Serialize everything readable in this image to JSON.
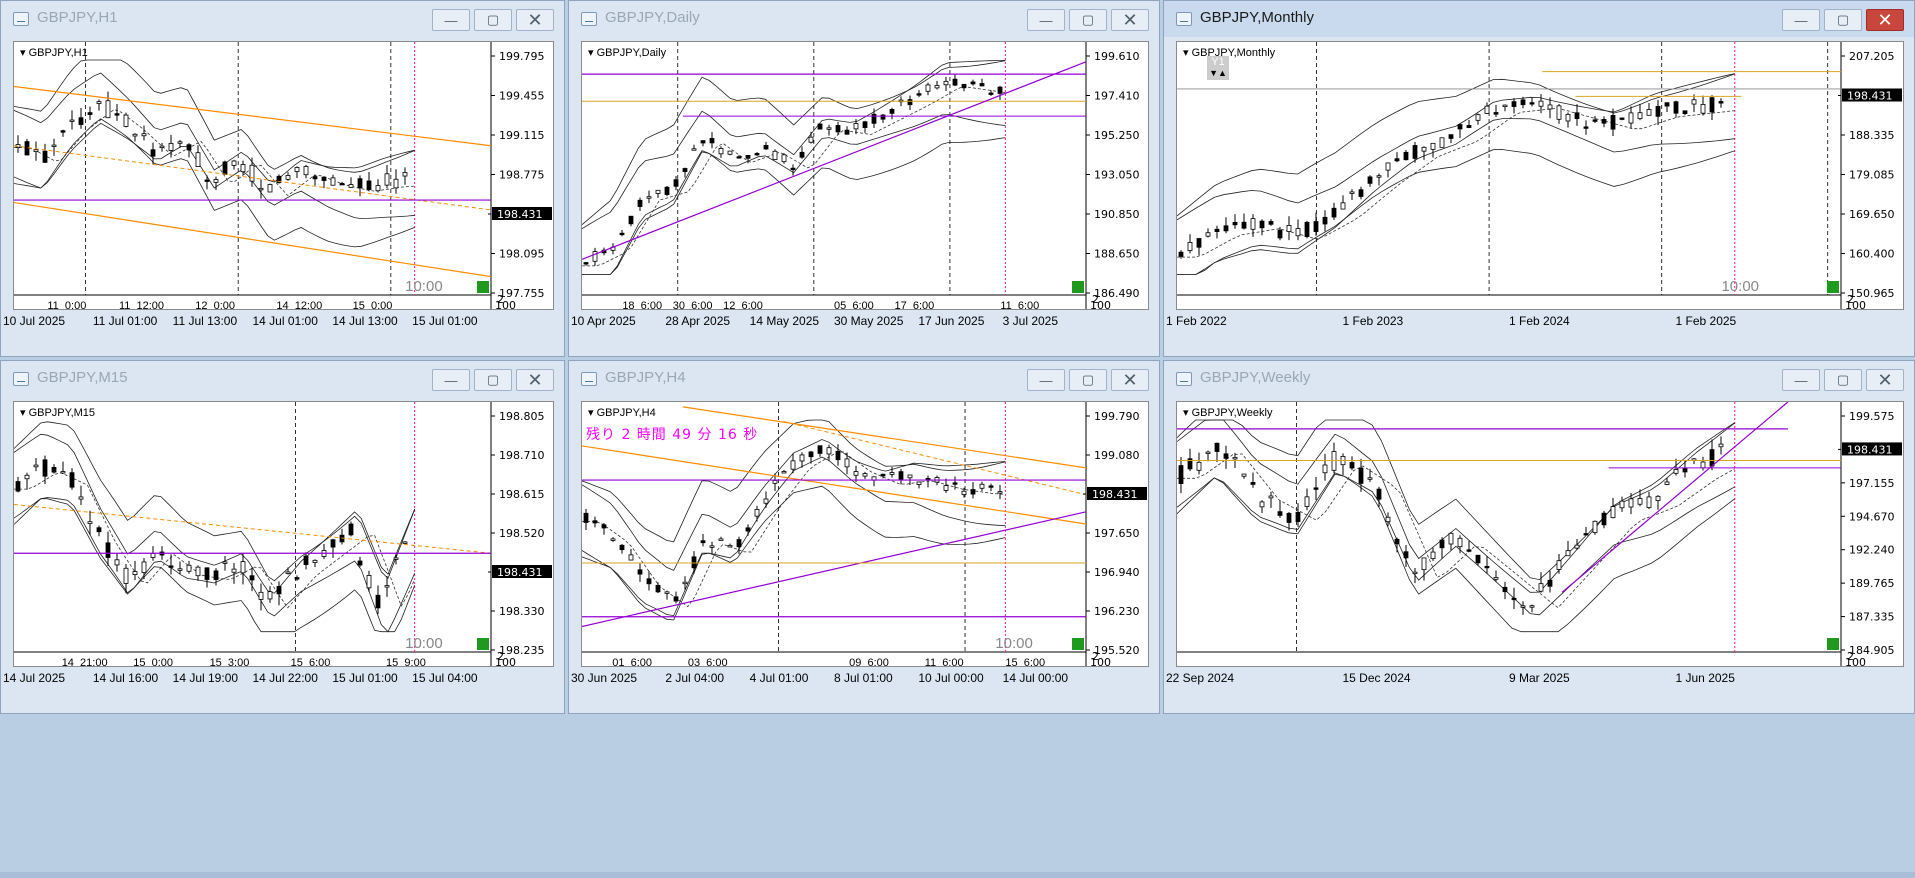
{
  "windows": [
    {
      "id": "h1",
      "title": "GBPJPY,H1",
      "symbol": "GBPJPY,H1",
      "active": false,
      "price_labels": [
        "199.795",
        "199.455",
        "199.115",
        "198.775",
        "198.431",
        "198.095",
        "197.755"
      ],
      "current_price": "198.431",
      "inner_time_labels": [
        "11_0:00",
        "11_12:00",
        "12_0:00",
        "14_12:00",
        "15_0:00"
      ],
      "date_labels": [
        "10 Jul 2025",
        "11 Jul 01:00",
        "11 Jul 13:00",
        "14 Jul 01:00",
        "14 Jul 13:00",
        "15 Jul 01:00"
      ],
      "time_left": "10:00",
      "corner_label": "2",
      "corner_label2": "0",
      "corner_label3": "100"
    },
    {
      "id": "daily",
      "title": "GBPJPY,Daily",
      "symbol": "GBPJPY,Daily",
      "active": false,
      "price_labels": [
        "199.610",
        "197.410",
        "195.250",
        "193.050",
        "190.850",
        "188.650",
        "186.490"
      ],
      "current_price": "198.431",
      "inner_time_labels": [
        "18_6:00",
        "30_6:00",
        "12_6:00",
        "05_6:00",
        "17_6:00",
        "11_6:00"
      ],
      "date_labels": [
        "10 Apr 2025",
        "28 Apr 2025",
        "14 May 2025",
        "30 May 2025",
        "17 Jun 2025",
        "3 Jul 2025"
      ],
      "time_left": "",
      "corner_label": "2",
      "corner_label2": "0",
      "corner_label3": "100"
    },
    {
      "id": "monthly",
      "title": "GBPJPY,Monthly",
      "symbol": "GBPJPY,Monthly",
      "active": true,
      "period_badge": "Y1",
      "price_labels": [
        "207.205",
        "198.431",
        "188.335",
        "179.085",
        "169.650",
        "160.400",
        "150.965"
      ],
      "current_price": "198.431",
      "inner_time_labels": [],
      "date_labels": [
        "1 Feb 2022",
        "1 Feb 2023",
        "1 Feb 2024",
        "1 Feb 2025"
      ],
      "time_left": "10:00",
      "corner_label": "2",
      "corner_label2": "0",
      "corner_label3": "100"
    },
    {
      "id": "m15",
      "title": "GBPJPY,M15",
      "symbol": "GBPJPY,M15",
      "active": false,
      "price_labels": [
        "198.805",
        "198.710",
        "198.615",
        "198.520",
        "198.431",
        "198.330",
        "198.235"
      ],
      "current_price": "198.431",
      "inner_time_labels": [
        "14_21:00",
        "15_0:00",
        "15_3:00",
        "15_6:00",
        "15_9:00"
      ],
      "date_labels": [
        "14 Jul 2025",
        "14 Jul 16:00",
        "14 Jul 19:00",
        "14 Jul 22:00",
        "15 Jul 01:00",
        "15 Jul 04:00"
      ],
      "time_left": "10:00",
      "corner_label": "2",
      "corner_label2": "0",
      "corner_label3": "100"
    },
    {
      "id": "h4",
      "title": "GBPJPY,H4",
      "symbol": "GBPJPY,H4",
      "active": false,
      "remaining": "残り 2 時間 49 分 16 秒",
      "price_labels": [
        "199.790",
        "199.080",
        "198.431",
        "197.650",
        "196.940",
        "196.230",
        "195.520"
      ],
      "current_price": "198.431",
      "inner_time_labels": [
        "01_6:00",
        "03_6:00",
        "09_6:00",
        "11_6:00",
        "15_6:00"
      ],
      "date_labels": [
        "30 Jun 2025",
        "2 Jul 04:00",
        "4 Jul 01:00",
        "8 Jul 01:00",
        "10 Jul 00:00",
        "14 Jul 00:00"
      ],
      "time_left": "10:00",
      "corner_label": "2",
      "corner_label2": "0",
      "corner_label3": "100"
    },
    {
      "id": "weekly",
      "title": "GBPJPY,Weekly",
      "symbol": "GBPJPY,Weekly",
      "active": false,
      "price_labels": [
        "199.575",
        "198.431",
        "197.155",
        "194.670",
        "192.240",
        "189.765",
        "187.335",
        "184.905"
      ],
      "current_price": "198.431",
      "inner_time_labels": [],
      "date_labels": [
        "22 Sep 2024",
        "15 Dec 2024",
        "9 Mar 2025",
        "1 Jun 2025"
      ],
      "time_left": "",
      "corner_label": "2",
      "corner_label2": "0",
      "corner_label3": "100"
    }
  ],
  "colors": {
    "purple": "#9400d3",
    "orange": "#ff8c00",
    "gold": "#daa520",
    "magenta": "#ff1493",
    "bull": "#ffffff",
    "bear": "#000000",
    "remaining_text": "#ff00ff"
  },
  "icons": {
    "window": "chart-window-icon",
    "minimize": "minimize-icon",
    "maximize": "maximize-icon",
    "close": "close-icon"
  }
}
